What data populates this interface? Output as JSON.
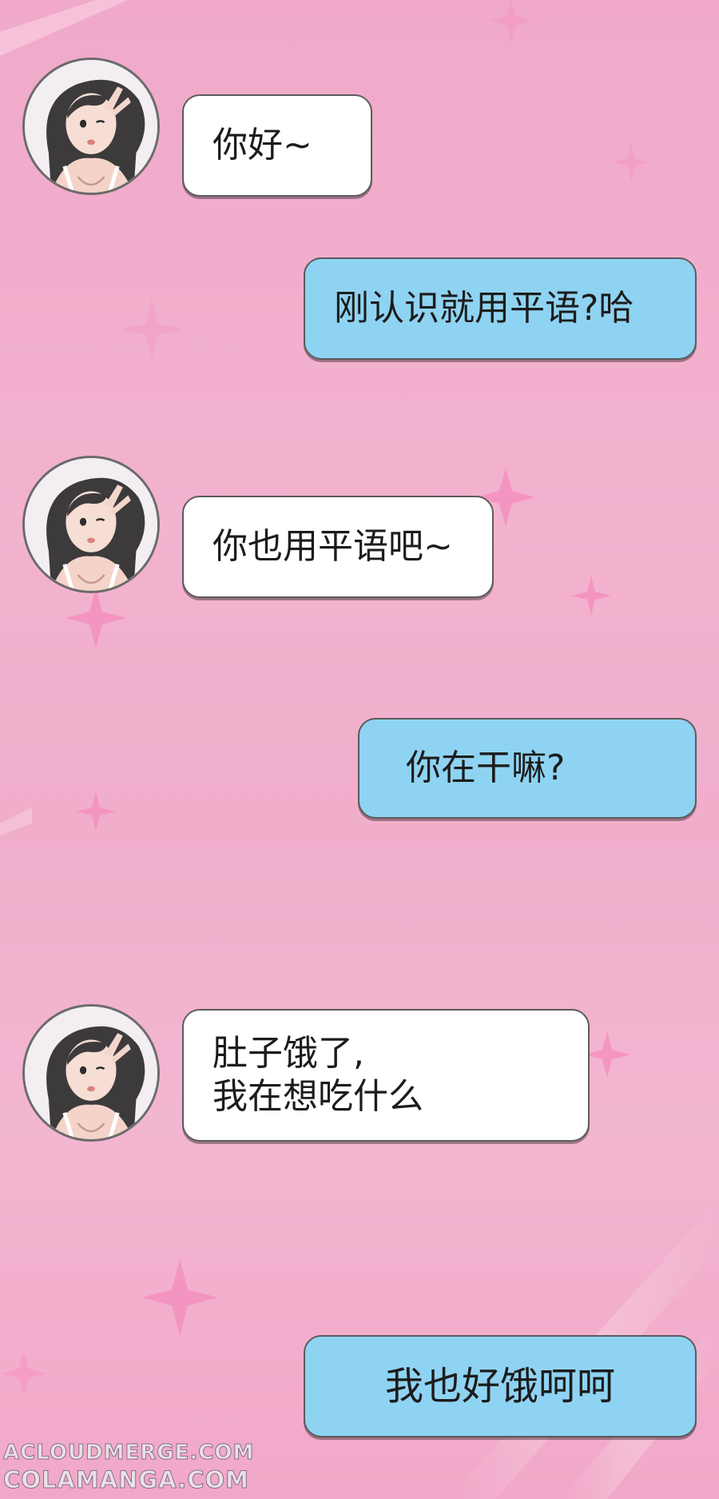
{
  "colors": {
    "background": "#f0aecb",
    "left_bubble": "#ffffff",
    "right_bubble": "#8fd3f2",
    "bubble_border": "#5b5b5b",
    "sparkle": "#f47fb4"
  },
  "messages": [
    {
      "side": "left",
      "avatar": "avatar-icon",
      "text": "你好~"
    },
    {
      "side": "right",
      "text": "刚认识就用平语?哈"
    },
    {
      "side": "left",
      "avatar": "avatar-icon",
      "text": "你也用平语吧~"
    },
    {
      "side": "right",
      "text": "你在干嘛?"
    },
    {
      "side": "left",
      "avatar": "avatar-icon",
      "text": "肚子饿了,\n我在想吃什么"
    },
    {
      "side": "right",
      "text": "我也好饿呵呵"
    }
  ],
  "watermarks": [
    "ACLOUDMERGE.COM",
    "COLAMANGA.COM"
  ]
}
